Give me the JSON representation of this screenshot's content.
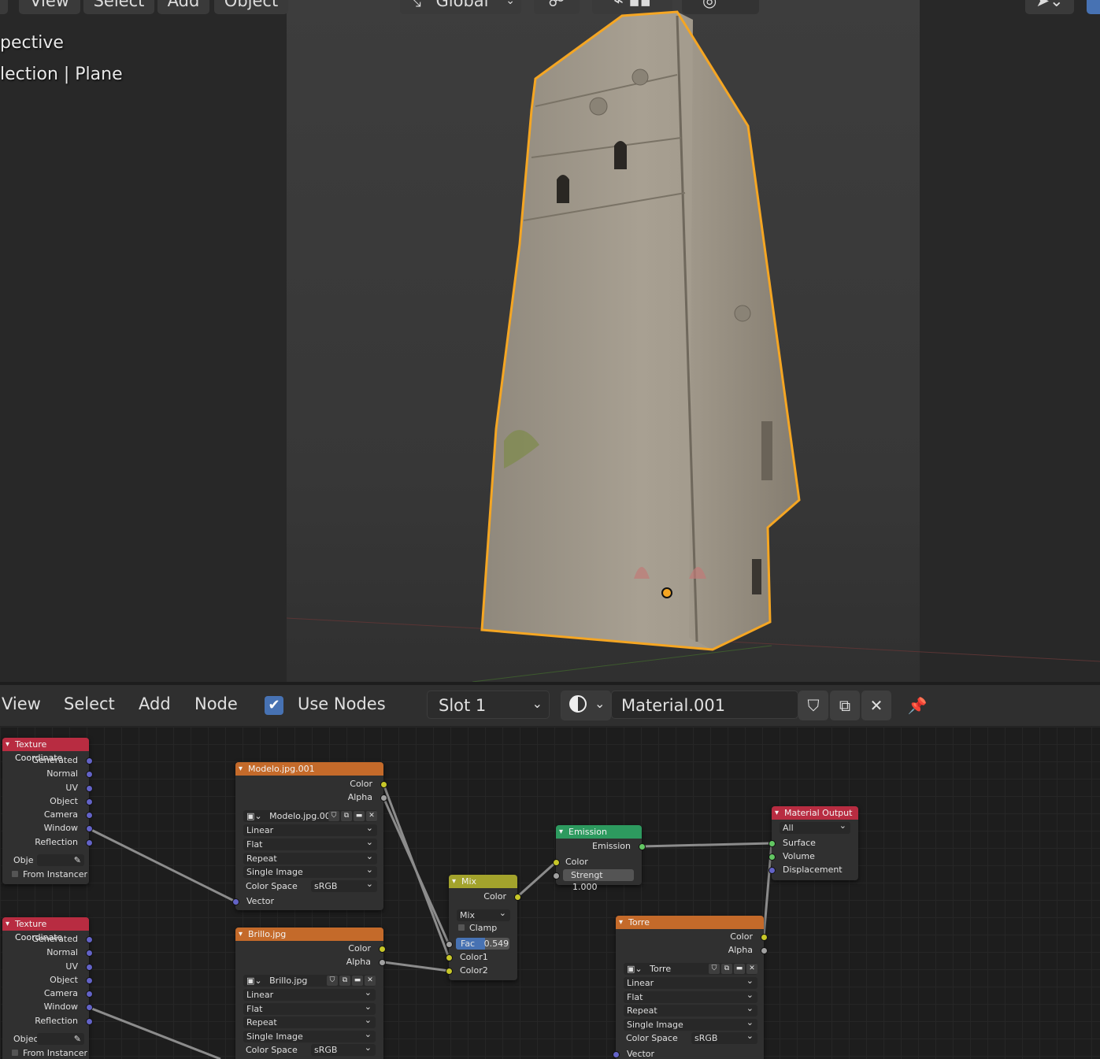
{
  "viewport": {
    "header_menu": [
      "View",
      "Select",
      "Add",
      "Object"
    ],
    "orientation": "Global",
    "overlay_line1": "pective",
    "overlay_line2": "lection | Plane"
  },
  "node_editor": {
    "menu": [
      "View",
      "Select",
      "Add",
      "Node"
    ],
    "use_nodes_label": "Use Nodes",
    "use_nodes_checked": true,
    "slot": "Slot 1",
    "material_name": "Material.001",
    "icons": [
      "shield-icon",
      "copy-icon",
      "close-icon",
      "pin-icon"
    ]
  },
  "nodes": {
    "tex1": {
      "title": "Texture Coordinate",
      "outputs": [
        "Generated",
        "Normal",
        "UV",
        "Object",
        "Camera",
        "Window",
        "Reflection"
      ],
      "object_label": "Obje",
      "from_instancer": "From Instancer"
    },
    "tex2": {
      "title": "Texture Coordinate",
      "outputs": [
        "Generated",
        "Normal",
        "UV",
        "Object",
        "Camera",
        "Window",
        "Reflection"
      ],
      "object_label": "Objec",
      "from_instancer": "From Instancer"
    },
    "modelo": {
      "title": "Modelo.jpg.001",
      "outputs": [
        "Color",
        "Alpha"
      ],
      "image": "Modelo.jpg.001",
      "interp": "Linear",
      "proj": "Flat",
      "ext": "Repeat",
      "source": "Single Image",
      "cs_label": "Color Space",
      "cs_value": "sRGB",
      "input": "Vector"
    },
    "brillo": {
      "title": "Brillo.jpg",
      "outputs": [
        "Color",
        "Alpha"
      ],
      "image": "Brillo.jpg",
      "interp": "Linear",
      "proj": "Flat",
      "ext": "Repeat",
      "source": "Single Image",
      "cs_label": "Color Space",
      "cs_value": "sRGB"
    },
    "mix": {
      "title": "Mix",
      "output": "Color",
      "blend": "Mix",
      "clamp": "Clamp",
      "fac_label": "Fac",
      "fac_value": "0.549",
      "fac": 0.549,
      "inputs": [
        "Color1",
        "Color2"
      ]
    },
    "emission": {
      "title": "Emission",
      "output": "Emission",
      "color": "Color",
      "strength_label": "Strengt",
      "strength_value": "1.000"
    },
    "output": {
      "title": "Material Output",
      "target": "All",
      "inputs": [
        "Surface",
        "Volume",
        "Displacement"
      ]
    },
    "torre": {
      "title": "Torre",
      "outputs": [
        "Color",
        "Alpha"
      ],
      "image": "Torre",
      "interp": "Linear",
      "proj": "Flat",
      "ext": "Repeat",
      "source": "Single Image",
      "cs_label": "Color Space",
      "cs_value": "sRGB",
      "input": "Vector"
    }
  },
  "colors": {
    "input_header": "#b82c41",
    "texture_header": "#c46a2a",
    "color_header": "#a3a32c",
    "shader_header": "#2d9a5f",
    "output_header": "#b82c41",
    "selection": "#f5a623"
  }
}
